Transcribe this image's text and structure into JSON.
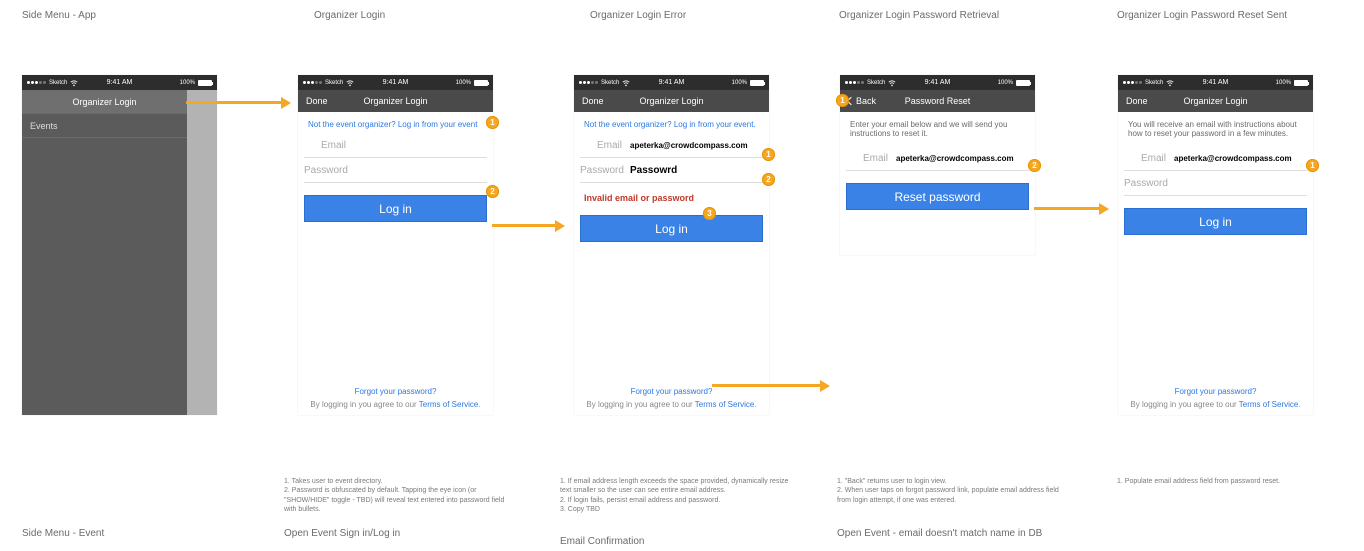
{
  "statusbar": {
    "carrier": "Sketch",
    "time": "9:41 AM",
    "pct": "100%"
  },
  "titles": {
    "c1": "Side Menu - App",
    "c2": "Organizer Login",
    "c3": "Organizer Login Error",
    "c4": "Organizer Login Password Retrieval",
    "c5": "Organizer Login Password Reset Sent",
    "r2a": "Side Menu - Event",
    "r2b": "Open Event Sign in/Log in",
    "r2c": "Email Confirmation",
    "r2d": "Open Event - email doesn't match name in DB"
  },
  "sidemenu": {
    "item_sel": "Organizer Login",
    "item_events": "Events"
  },
  "nav": {
    "done": "Done",
    "back": "Back",
    "title_login": "Organizer Login",
    "title_reset": "Password Reset"
  },
  "login": {
    "not_organizer_link": "Not the event organizer? Log in from your event",
    "not_organizer_plain": "Not the event organizer? Log in from your event.",
    "email_label": "Email",
    "password_label": "Password",
    "login_btn": "Log in",
    "forgot": "Forgot your password?",
    "terms_pre": "By logging in you agree to our ",
    "terms_link": "Terms of Service",
    "terms_post": "."
  },
  "error": {
    "email_val": "apeterka@crowdcompass.com",
    "pwd_val": "Passowrd",
    "msg": "Invalid email or password"
  },
  "reset": {
    "intro": "Enter your email below and we will send you instructions to reset it.",
    "email_val": "apeterka@crowdcompass.com",
    "btn": "Reset password"
  },
  "sent": {
    "intro": "You will receive an email with instructions about how to reset your password in a few minutes.",
    "email_val": "apeterka@crowdcompass.com"
  },
  "notes": {
    "n2a": "1. Takes user to event directory.",
    "n2b": "2. Password is obfuscated by default. Tapping the eye icon (or \"SHOW/HIDE\" toggle - TBD) will reveal text entered into password field with bullets.",
    "n3a": "1. If email address length exceeds the space provided, dynamically resize text smaller so the user can see entire email address.",
    "n3b": "2. If login fails, persist email address and password.",
    "n3c": "3. Copy TBD",
    "n4a": "1. \"Back\" returns user to login view.",
    "n4b": "2. When user taps on forgot password link, populate email address field from login attempt, if one was entered.",
    "n5a": "1. Populate email address field from password reset."
  },
  "badges": {
    "b1": "1",
    "b2": "2",
    "b3": "3"
  }
}
